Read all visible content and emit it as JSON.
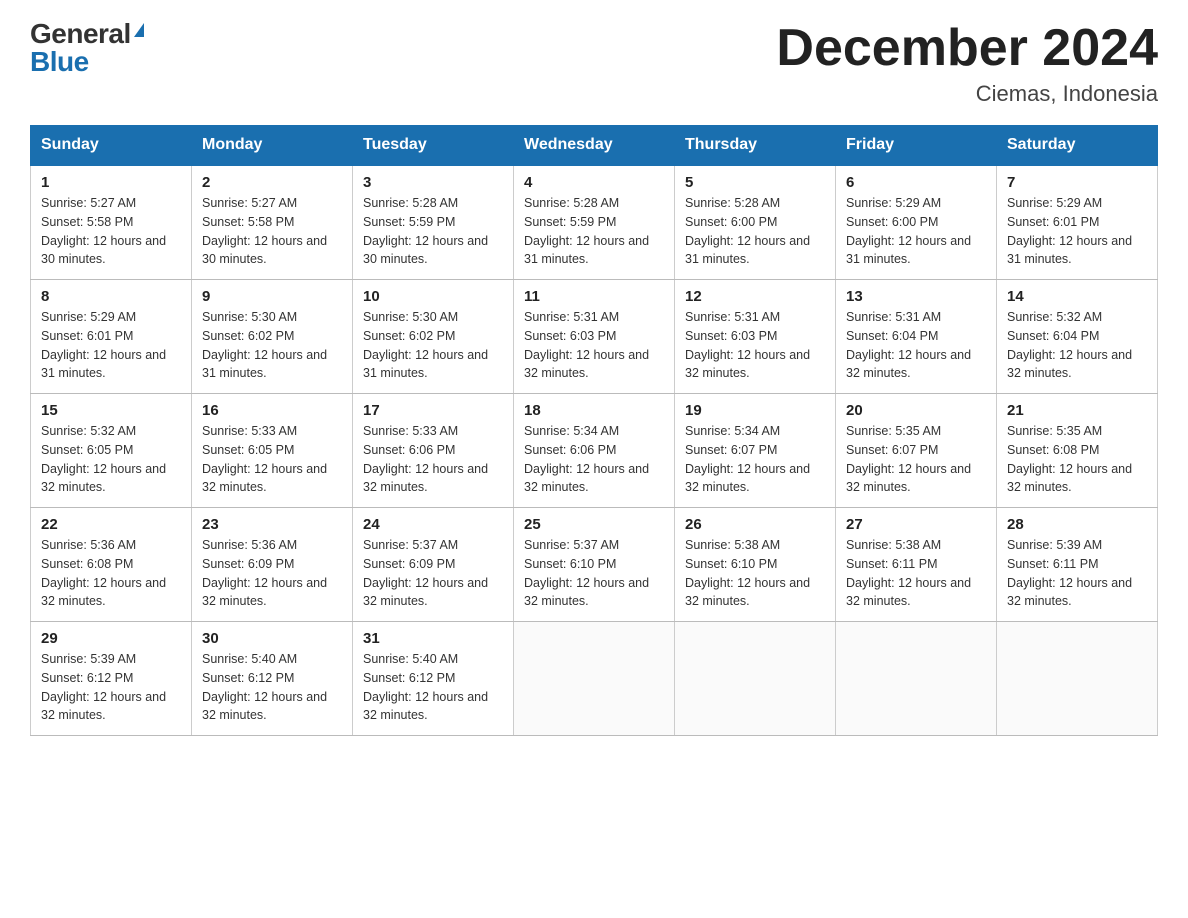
{
  "header": {
    "logo_general": "General",
    "logo_blue": "Blue",
    "title": "December 2024",
    "subtitle": "Ciemas, Indonesia"
  },
  "days_of_week": [
    "Sunday",
    "Monday",
    "Tuesday",
    "Wednesday",
    "Thursday",
    "Friday",
    "Saturday"
  ],
  "weeks": [
    [
      {
        "day": "1",
        "sunrise": "5:27 AM",
        "sunset": "5:58 PM",
        "daylight": "12 hours and 30 minutes."
      },
      {
        "day": "2",
        "sunrise": "5:27 AM",
        "sunset": "5:58 PM",
        "daylight": "12 hours and 30 minutes."
      },
      {
        "day": "3",
        "sunrise": "5:28 AM",
        "sunset": "5:59 PM",
        "daylight": "12 hours and 30 minutes."
      },
      {
        "day": "4",
        "sunrise": "5:28 AM",
        "sunset": "5:59 PM",
        "daylight": "12 hours and 31 minutes."
      },
      {
        "day": "5",
        "sunrise": "5:28 AM",
        "sunset": "6:00 PM",
        "daylight": "12 hours and 31 minutes."
      },
      {
        "day": "6",
        "sunrise": "5:29 AM",
        "sunset": "6:00 PM",
        "daylight": "12 hours and 31 minutes."
      },
      {
        "day": "7",
        "sunrise": "5:29 AM",
        "sunset": "6:01 PM",
        "daylight": "12 hours and 31 minutes."
      }
    ],
    [
      {
        "day": "8",
        "sunrise": "5:29 AM",
        "sunset": "6:01 PM",
        "daylight": "12 hours and 31 minutes."
      },
      {
        "day": "9",
        "sunrise": "5:30 AM",
        "sunset": "6:02 PM",
        "daylight": "12 hours and 31 minutes."
      },
      {
        "day": "10",
        "sunrise": "5:30 AM",
        "sunset": "6:02 PM",
        "daylight": "12 hours and 31 minutes."
      },
      {
        "day": "11",
        "sunrise": "5:31 AM",
        "sunset": "6:03 PM",
        "daylight": "12 hours and 32 minutes."
      },
      {
        "day": "12",
        "sunrise": "5:31 AM",
        "sunset": "6:03 PM",
        "daylight": "12 hours and 32 minutes."
      },
      {
        "day": "13",
        "sunrise": "5:31 AM",
        "sunset": "6:04 PM",
        "daylight": "12 hours and 32 minutes."
      },
      {
        "day": "14",
        "sunrise": "5:32 AM",
        "sunset": "6:04 PM",
        "daylight": "12 hours and 32 minutes."
      }
    ],
    [
      {
        "day": "15",
        "sunrise": "5:32 AM",
        "sunset": "6:05 PM",
        "daylight": "12 hours and 32 minutes."
      },
      {
        "day": "16",
        "sunrise": "5:33 AM",
        "sunset": "6:05 PM",
        "daylight": "12 hours and 32 minutes."
      },
      {
        "day": "17",
        "sunrise": "5:33 AM",
        "sunset": "6:06 PM",
        "daylight": "12 hours and 32 minutes."
      },
      {
        "day": "18",
        "sunrise": "5:34 AM",
        "sunset": "6:06 PM",
        "daylight": "12 hours and 32 minutes."
      },
      {
        "day": "19",
        "sunrise": "5:34 AM",
        "sunset": "6:07 PM",
        "daylight": "12 hours and 32 minutes."
      },
      {
        "day": "20",
        "sunrise": "5:35 AM",
        "sunset": "6:07 PM",
        "daylight": "12 hours and 32 minutes."
      },
      {
        "day": "21",
        "sunrise": "5:35 AM",
        "sunset": "6:08 PM",
        "daylight": "12 hours and 32 minutes."
      }
    ],
    [
      {
        "day": "22",
        "sunrise": "5:36 AM",
        "sunset": "6:08 PM",
        "daylight": "12 hours and 32 minutes."
      },
      {
        "day": "23",
        "sunrise": "5:36 AM",
        "sunset": "6:09 PM",
        "daylight": "12 hours and 32 minutes."
      },
      {
        "day": "24",
        "sunrise": "5:37 AM",
        "sunset": "6:09 PM",
        "daylight": "12 hours and 32 minutes."
      },
      {
        "day": "25",
        "sunrise": "5:37 AM",
        "sunset": "6:10 PM",
        "daylight": "12 hours and 32 minutes."
      },
      {
        "day": "26",
        "sunrise": "5:38 AM",
        "sunset": "6:10 PM",
        "daylight": "12 hours and 32 minutes."
      },
      {
        "day": "27",
        "sunrise": "5:38 AM",
        "sunset": "6:11 PM",
        "daylight": "12 hours and 32 minutes."
      },
      {
        "day": "28",
        "sunrise": "5:39 AM",
        "sunset": "6:11 PM",
        "daylight": "12 hours and 32 minutes."
      }
    ],
    [
      {
        "day": "29",
        "sunrise": "5:39 AM",
        "sunset": "6:12 PM",
        "daylight": "12 hours and 32 minutes."
      },
      {
        "day": "30",
        "sunrise": "5:40 AM",
        "sunset": "6:12 PM",
        "daylight": "12 hours and 32 minutes."
      },
      {
        "day": "31",
        "sunrise": "5:40 AM",
        "sunset": "6:12 PM",
        "daylight": "12 hours and 32 minutes."
      },
      null,
      null,
      null,
      null
    ]
  ],
  "labels": {
    "sunrise_prefix": "Sunrise: ",
    "sunset_prefix": "Sunset: ",
    "daylight_prefix": "Daylight: "
  }
}
